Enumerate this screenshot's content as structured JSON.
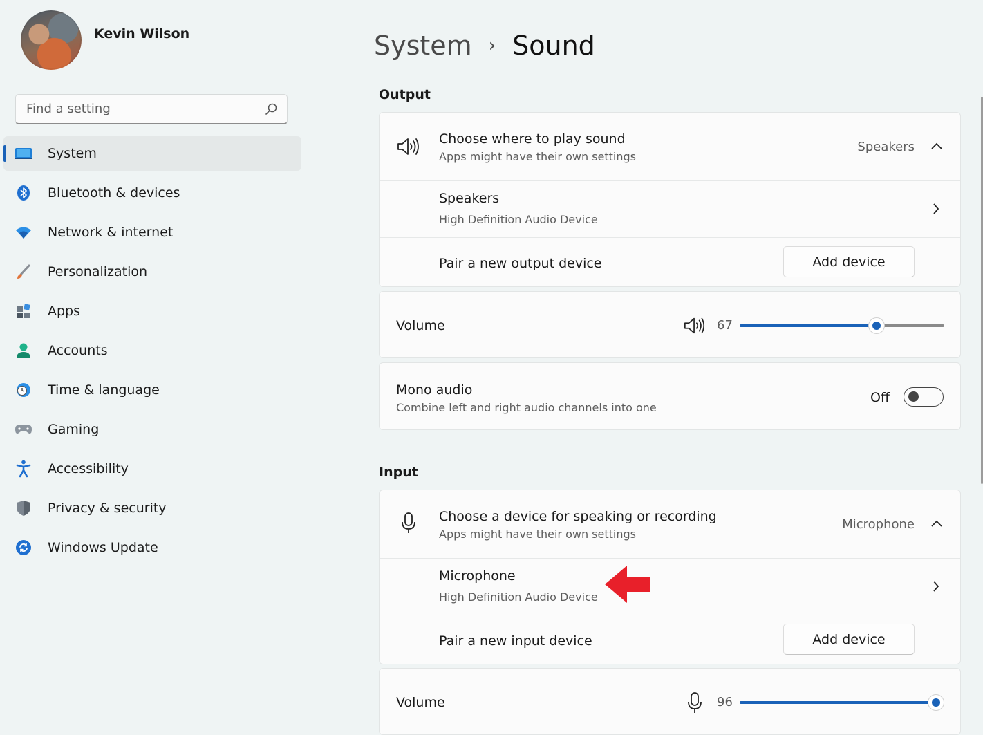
{
  "profile": {
    "name": "Kevin Wilson"
  },
  "search": {
    "placeholder": "Find a setting"
  },
  "sidebar": {
    "items": [
      {
        "label": "System",
        "icon": "system-icon"
      },
      {
        "label": "Bluetooth & devices",
        "icon": "bluetooth-icon"
      },
      {
        "label": "Network & internet",
        "icon": "wifi-icon"
      },
      {
        "label": "Personalization",
        "icon": "brush-icon"
      },
      {
        "label": "Apps",
        "icon": "apps-icon"
      },
      {
        "label": "Accounts",
        "icon": "accounts-icon"
      },
      {
        "label": "Time & language",
        "icon": "clock-globe-icon"
      },
      {
        "label": "Gaming",
        "icon": "gamepad-icon"
      },
      {
        "label": "Accessibility",
        "icon": "accessibility-icon"
      },
      {
        "label": "Privacy & security",
        "icon": "shield-icon"
      },
      {
        "label": "Windows Update",
        "icon": "update-icon"
      }
    ],
    "active": "System"
  },
  "breadcrumb": {
    "parent": "System",
    "separator": "›",
    "current": "Sound"
  },
  "output": {
    "label": "Output",
    "choose_title": "Choose where to play sound",
    "choose_sub": "Apps might have their own settings",
    "selected": "Speakers",
    "device_name": "Speakers",
    "device_desc": "High Definition Audio Device",
    "pair_label": "Pair a new output device",
    "add_button": "Add device",
    "volume_label": "Volume",
    "volume_value": "67",
    "volume_fraction": 0.67,
    "mono_title": "Mono audio",
    "mono_sub": "Combine left and right audio channels into one",
    "mono_state": "Off"
  },
  "input": {
    "label": "Input",
    "choose_title": "Choose a device for speaking or recording",
    "choose_sub": "Apps might have their own settings",
    "selected": "Microphone",
    "device_name": "Microphone",
    "device_desc": "High Definition Audio Device",
    "pair_label": "Pair a new input device",
    "add_button": "Add device",
    "volume_label": "Volume",
    "volume_value": "96",
    "volume_fraction": 0.96
  },
  "colors": {
    "accent": "#1a62b8",
    "arrow": "#e8202a",
    "background": "#eff4f4"
  }
}
